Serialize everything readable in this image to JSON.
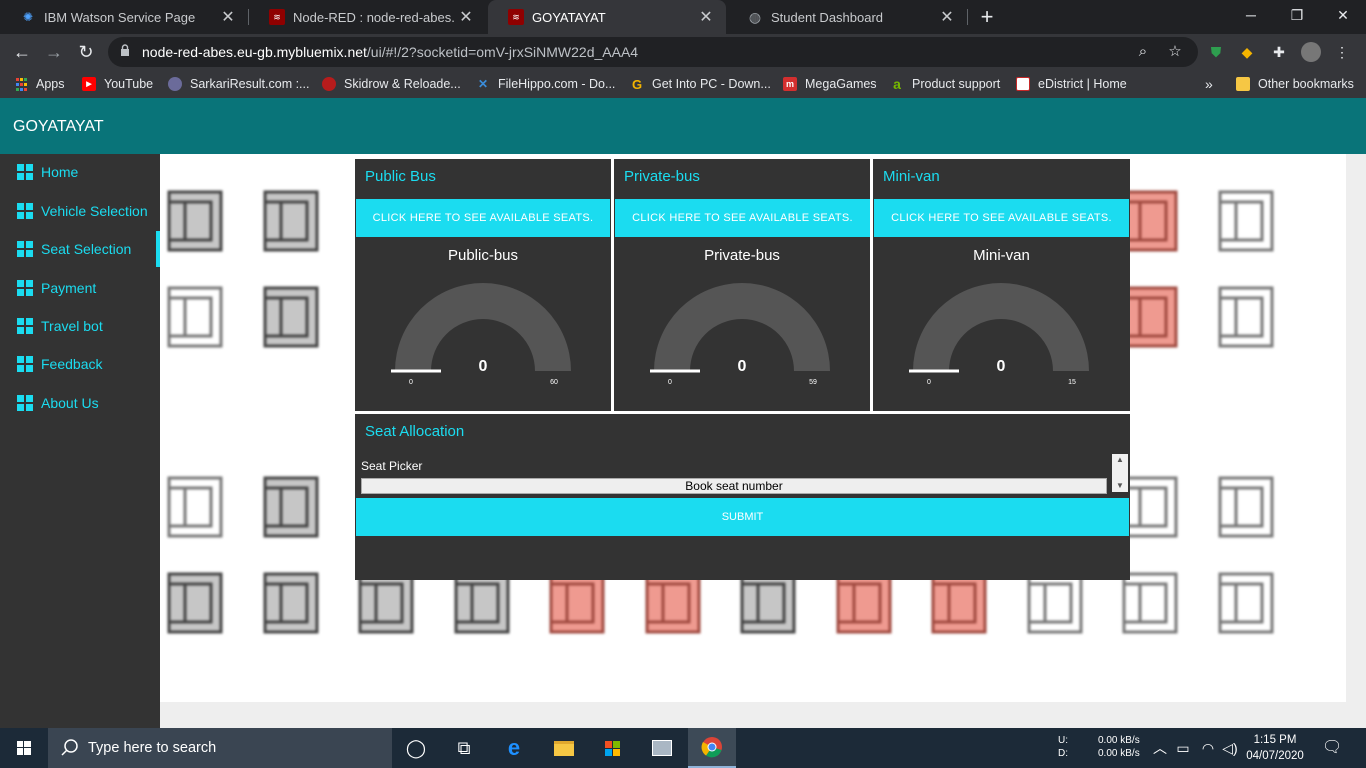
{
  "browser": {
    "tabs": [
      {
        "title": "IBM Watson Service Page",
        "icon": "ibm-icon"
      },
      {
        "title": "Node-RED : node-red-abes.eu-gb",
        "icon": "node-red-icon"
      },
      {
        "title": "GOYATAYAT",
        "icon": "node-red-icon"
      },
      {
        "title": "Student Dashboard",
        "icon": "globe-icon"
      }
    ],
    "new_tab": "+",
    "url_host": "node-red-abes.eu-gb.mybluemix.net",
    "url_path": "/ui/#!/2?socketid=omV-jrxSiNMW22d_AAA4",
    "bookmarks": [
      {
        "label": "Apps",
        "color": "#e8453c"
      },
      {
        "label": "YouTube",
        "color": "#ff0000"
      },
      {
        "label": "SarkariResult.com :...",
        "color": "#6b6b9a"
      },
      {
        "label": "Skidrow & Reloade...",
        "color": "#b71c1c"
      },
      {
        "label": "FileHippo.com - Do...",
        "color": "#3b8ddb"
      },
      {
        "label": "Get Into PC - Down...",
        "color": "#f4b400"
      },
      {
        "label": "MegaGames",
        "color": "#d32f2f"
      },
      {
        "label": "Product support",
        "color": "#76b900"
      },
      {
        "label": "eDistrict | Home",
        "color": "#c62828"
      }
    ],
    "overflow": "»",
    "other_bookmarks": "Other bookmarks"
  },
  "app": {
    "title": "GOYATAYAT",
    "nav": [
      {
        "label": "Home"
      },
      {
        "label": "Vehicle Selection"
      },
      {
        "label": "Seat Selection"
      },
      {
        "label": "Payment"
      },
      {
        "label": "Travel bot"
      },
      {
        "label": "Feedback"
      },
      {
        "label": "About Us"
      }
    ],
    "active_nav": "Seat Selection",
    "accent_color": "#1bdcf0",
    "header_color": "#097479",
    "cards": [
      {
        "title": "Public Bus",
        "button": "CLICK HERE TO SEE AVAILABLE SEATS.",
        "gauge_label": "Public-bus",
        "value": "0",
        "min": "0",
        "max": "60",
        "value_num": 0,
        "max_num": 60
      },
      {
        "title": "Private-bus",
        "button": "CLICK HERE TO SEE AVAILABLE SEATS.",
        "gauge_label": "Private-bus",
        "value": "0",
        "min": "0",
        "max": "59",
        "value_num": 0,
        "max_num": 59
      },
      {
        "title": "Mini-van",
        "button": "CLICK HERE TO SEE AVAILABLE SEATS.",
        "gauge_label": "Mini-van",
        "value": "0",
        "min": "0",
        "max": "15",
        "value_num": 0,
        "max_num": 15
      }
    ],
    "allocation": {
      "title": "Seat Allocation",
      "picker_label": "Seat Picker",
      "picker_value": "Book seat number",
      "submit": "SUBMIT"
    }
  },
  "taskbar": {
    "search_placeholder": "Type here to search",
    "net_up_label": "U:",
    "net_down_label": "D:",
    "net_up": "0.00 kB/s",
    "net_down": "0.00 kB/s",
    "time": "1:15 PM",
    "date": "04/07/2020"
  }
}
